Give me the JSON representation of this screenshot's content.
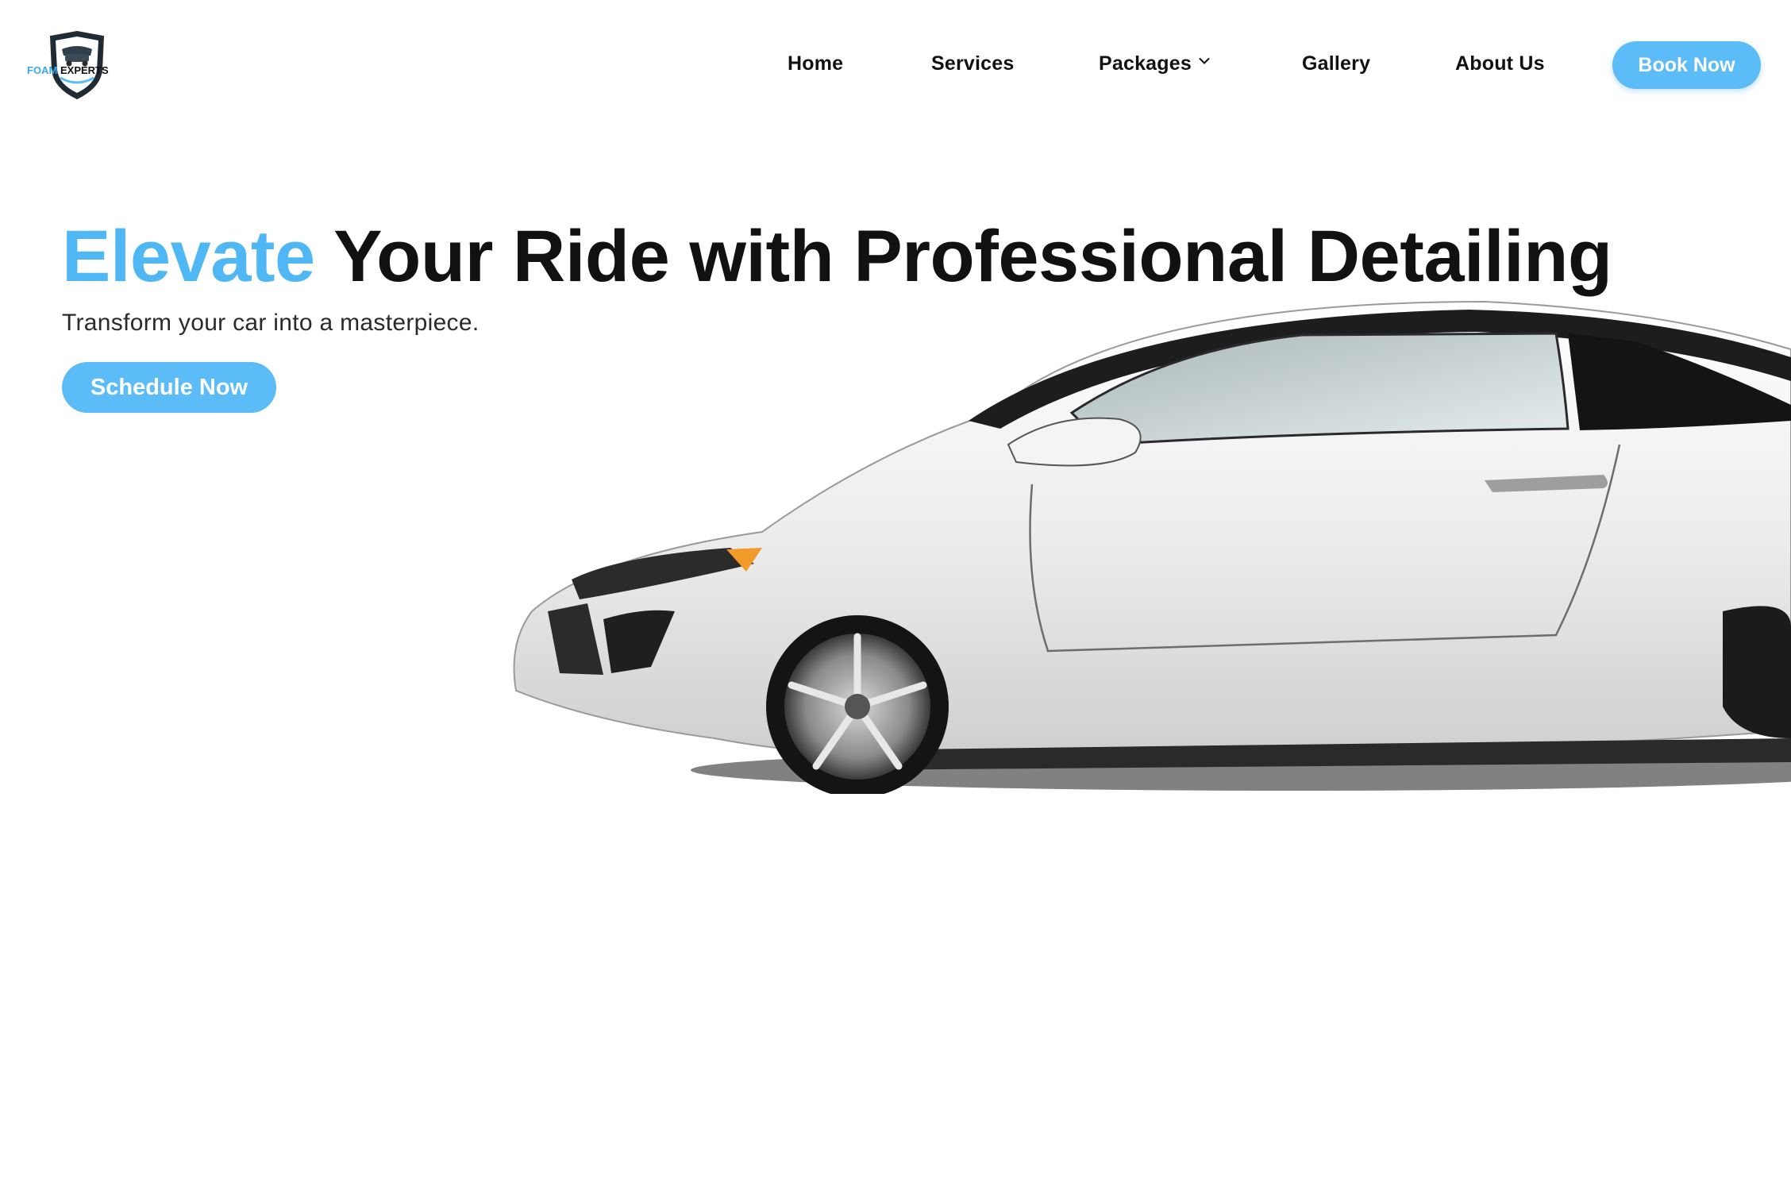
{
  "header": {
    "logo": {
      "brand_part1": "FOAM",
      "brand_part2": "EXPERTS"
    },
    "nav": [
      {
        "label": "Home"
      },
      {
        "label": "Services"
      },
      {
        "label": "Packages",
        "icon": "chevron-down-icon"
      },
      {
        "label": "Gallery"
      },
      {
        "label": "About Us"
      }
    ],
    "book_button": "Book Now"
  },
  "hero": {
    "title_accent": "Elevate",
    "title_rest": " Your Ride with Professional Detailing",
    "subtitle": "Transform your car into a masterpiece.",
    "cta": "Schedule Now",
    "image": "white-sports-car"
  },
  "colors": {
    "accent": "#5bbcf7",
    "heading": "#111111",
    "background": "#ffffff"
  }
}
